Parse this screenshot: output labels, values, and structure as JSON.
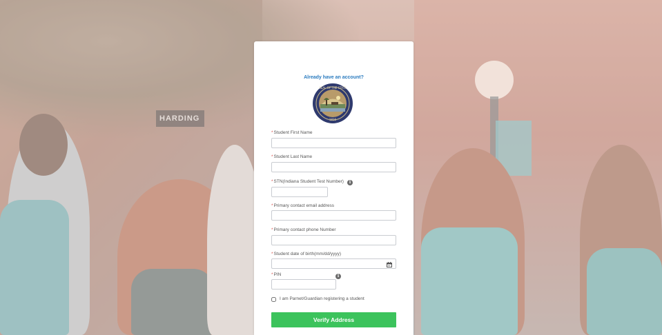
{
  "header": {
    "login_link": "Already have an account?"
  },
  "background": {
    "sign_text": "HARDING"
  },
  "form": {
    "first_name": {
      "label": "Student First Name",
      "value": ""
    },
    "last_name": {
      "label": "Student Last Name",
      "value": ""
    },
    "stn": {
      "label": "STN(Indiana Student Test Number)",
      "value": ""
    },
    "email": {
      "label": "Primary contact email address",
      "value": ""
    },
    "phone": {
      "label": "Primary contact phone Number",
      "value": ""
    },
    "dob": {
      "label": "Student date of birth(mm/dd/yyyy)",
      "value": ""
    },
    "pin": {
      "label": "PIN",
      "value": ""
    },
    "required_marker": "*",
    "parent_checkbox_label": "I am Parnet/Guardian registering a student",
    "parent_checkbox_checked": false,
    "submit_label": "Verify Address"
  },
  "icons": {
    "seal": "indiana-state-seal-icon",
    "info": "info-icon",
    "calendar": "calendar-icon"
  },
  "colors": {
    "link": "#2a7bbf",
    "button": "#3cc35c",
    "required": "#d9534f"
  }
}
